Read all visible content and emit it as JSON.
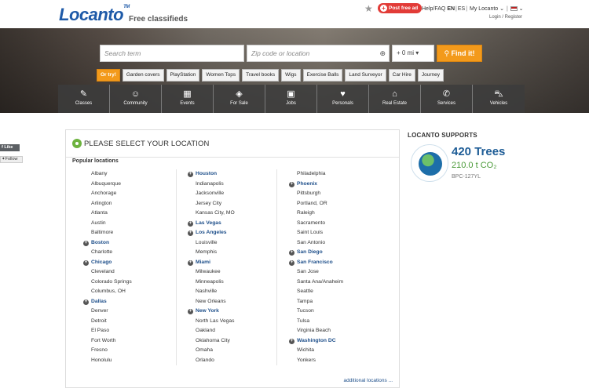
{
  "header": {
    "logo": "Locanto",
    "tagline": "Free classifieds",
    "post_ad": "Post free ad",
    "links": {
      "help": "Help/FAQ",
      "lang_en": "EN",
      "lang_es": "ES",
      "my": "My Locanto"
    },
    "login": "Login / Register"
  },
  "search": {
    "term_placeholder": "Search term",
    "zip_placeholder": "Zip code or location",
    "distance": "+  0 mi",
    "find_label": "Find it!"
  },
  "suggestions": {
    "try_label": "Or try!",
    "items": [
      "Garden covers",
      "PlayStation",
      "Women Tops",
      "Travel books",
      "Wigs",
      "Exercise Balls",
      "Land Surveyor",
      "Car Hire",
      "Journey"
    ]
  },
  "categories": [
    "Classes",
    "Community",
    "Events",
    "For Sale",
    "Jobs",
    "Personals",
    "Real Estate",
    "Services",
    "Vehicles"
  ],
  "social": {
    "like": "Like",
    "follow": "Follow"
  },
  "locations": {
    "title": "PLEASE SELECT YOUR LOCATION",
    "popular": "Popular locations",
    "col1": [
      {
        "name": "Albany",
        "major": false
      },
      {
        "name": "Albuquerque",
        "major": false
      },
      {
        "name": "Anchorage",
        "major": false
      },
      {
        "name": "Arlington",
        "major": false
      },
      {
        "name": "Atlanta",
        "major": false
      },
      {
        "name": "Austin",
        "major": false
      },
      {
        "name": "Baltimore",
        "major": false
      },
      {
        "name": "Boston",
        "major": true
      },
      {
        "name": "Charlotte",
        "major": false
      },
      {
        "name": "Chicago",
        "major": true
      },
      {
        "name": "Cleveland",
        "major": false
      },
      {
        "name": "Colorado Springs",
        "major": false
      },
      {
        "name": "Columbus, OH",
        "major": false
      },
      {
        "name": "Dallas",
        "major": true
      },
      {
        "name": "Denver",
        "major": false
      },
      {
        "name": "Detroit",
        "major": false
      },
      {
        "name": "El Paso",
        "major": false
      },
      {
        "name": "Fort Worth",
        "major": false
      },
      {
        "name": "Fresno",
        "major": false
      },
      {
        "name": "Honolulu",
        "major": false
      }
    ],
    "col2": [
      {
        "name": "Houston",
        "major": true
      },
      {
        "name": "Indianapolis",
        "major": false
      },
      {
        "name": "Jacksonville",
        "major": false
      },
      {
        "name": "Jersey City",
        "major": false
      },
      {
        "name": "Kansas City, MO",
        "major": false
      },
      {
        "name": "Las Vegas",
        "major": true
      },
      {
        "name": "Los Angeles",
        "major": true
      },
      {
        "name": "Louisville",
        "major": false
      },
      {
        "name": "Memphis",
        "major": false
      },
      {
        "name": "Miami",
        "major": true
      },
      {
        "name": "Milwaukee",
        "major": false
      },
      {
        "name": "Minneapolis",
        "major": false
      },
      {
        "name": "Nashville",
        "major": false
      },
      {
        "name": "New Orleans",
        "major": false
      },
      {
        "name": "New York",
        "major": true
      },
      {
        "name": "North Las Vegas",
        "major": false
      },
      {
        "name": "Oakland",
        "major": false
      },
      {
        "name": "Oklahoma City",
        "major": false
      },
      {
        "name": "Omaha",
        "major": false
      },
      {
        "name": "Orlando",
        "major": false
      }
    ],
    "col3": [
      {
        "name": "Philadelphia",
        "major": false
      },
      {
        "name": "Phoenix",
        "major": true
      },
      {
        "name": "Pittsburgh",
        "major": false
      },
      {
        "name": "Portland, OR",
        "major": false
      },
      {
        "name": "Raleigh",
        "major": false
      },
      {
        "name": "Sacramento",
        "major": false
      },
      {
        "name": "Saint Louis",
        "major": false
      },
      {
        "name": "San Antonio",
        "major": false
      },
      {
        "name": "San Diego",
        "major": true
      },
      {
        "name": "San Francisco",
        "major": true
      },
      {
        "name": "San Jose",
        "major": false
      },
      {
        "name": "Santa Ana/Anaheim",
        "major": false
      },
      {
        "name": "Seattle",
        "major": false
      },
      {
        "name": "Tampa",
        "major": false
      },
      {
        "name": "Tucson",
        "major": false
      },
      {
        "name": "Tulsa",
        "major": false
      },
      {
        "name": "Virginia Beach",
        "major": false
      },
      {
        "name": "Washington DC",
        "major": true
      },
      {
        "name": "Wichita",
        "major": false
      },
      {
        "name": "Yonkers",
        "major": false
      }
    ],
    "more": "additional locations ..."
  },
  "sidebar": {
    "supports": "LOCANTO SUPPORTS",
    "trees": "420 Trees",
    "co2": "210.0 t CO₂",
    "code": "BPC-127YL"
  }
}
